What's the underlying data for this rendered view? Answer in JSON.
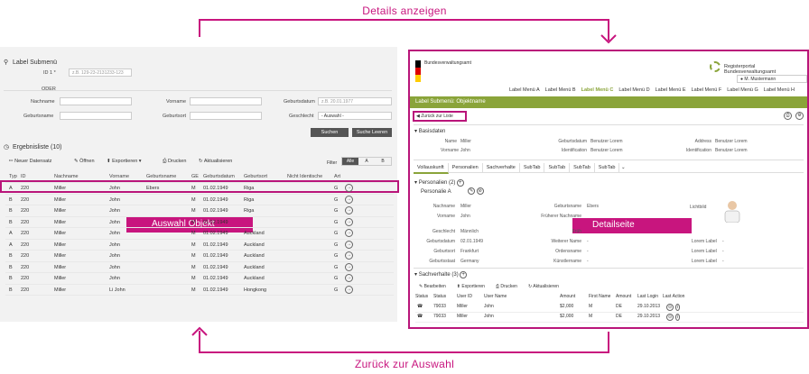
{
  "annotations": {
    "top": "Details anzeigen",
    "bottom": "Zurück zur Auswahl",
    "left_overlay": "Auswahl Objekt",
    "right_overlay": "Detailseite"
  },
  "left": {
    "title": "Label Submenü",
    "id_label": "ID 1 *",
    "id_placeholder": "z.B. 129-23-2131233-123",
    "oder": "ODER",
    "fields": {
      "nachname": "Nachname",
      "vorname": "Vorname",
      "geburtsdatum": "Geburtsdatum",
      "geburtsdatum_placeholder": "z.B. 20.01.1977",
      "geburtsname": "Geburtsname",
      "geburtsort": "Geburtsort",
      "geschlecht": "Geschlecht",
      "geschlecht_value": "- Auswahl -"
    },
    "search_btn": "Suchen",
    "reset_btn": "Suche Leeren",
    "results_title": "Ergebnisliste (10)",
    "toolbar": {
      "new": "Neuer Datensatz",
      "open": "Öffnen",
      "export": "Exportieren",
      "print": "Drucken",
      "refresh": "Aktualisieren"
    },
    "filter": {
      "label": "Filter",
      "options": [
        "Alle",
        "A",
        "B"
      ]
    },
    "columns": [
      "Typ",
      "ID",
      "Nachname",
      "Vorname",
      "Geburtsname",
      "GE",
      "Geburtsdatum",
      "Geburtsort",
      "Nicht Identische",
      "Art"
    ],
    "rows": [
      [
        "A",
        "220",
        "Miller",
        "John",
        "Ebers",
        "M",
        "01.02.1949",
        "Riga",
        "G"
      ],
      [
        "B",
        "220",
        "Miller",
        "John",
        "",
        "M",
        "01.02.1949",
        "Riga",
        "G"
      ],
      [
        "B",
        "220",
        "Miller",
        "John",
        "",
        "M",
        "01.02.1949",
        "Riga",
        "G"
      ],
      [
        "B",
        "220",
        "Miller",
        "John",
        "",
        "M",
        "01.02.1949",
        "",
        "G"
      ],
      [
        "A",
        "220",
        "Miller",
        "John",
        "",
        "M",
        "01.02.1949",
        "Auckland",
        "G"
      ],
      [
        "A",
        "220",
        "Miller",
        "John",
        "",
        "M",
        "01.02.1949",
        "Auckland",
        "G"
      ],
      [
        "B",
        "220",
        "Miller",
        "John",
        "",
        "M",
        "01.02.1949",
        "Auckland",
        "G"
      ],
      [
        "B",
        "220",
        "Miller",
        "John",
        "",
        "M",
        "01.02.1949",
        "Auckland",
        "G"
      ],
      [
        "B",
        "220",
        "Miller",
        "John",
        "",
        "M",
        "01.02.1949",
        "Auckland",
        "G"
      ],
      [
        "B",
        "220",
        "Miller",
        "Li John",
        "",
        "M",
        "01.02.1949",
        "Hongkong",
        "G"
      ]
    ]
  },
  "right": {
    "agency": "Bundesverwaltungsamt",
    "portal": "Registerportal Bundesverwaltungsamt",
    "user": "M. Mustermann",
    "menu": [
      "Label Menü A",
      "Label Menü B",
      "Label Menü C",
      "Label Menü D",
      "Label Menü E",
      "Label Menü F",
      "Label Menü G",
      "Label Menü H"
    ],
    "breadcrumb": "Label Submenü: Objektname",
    "back_btn": "Zurück zur Liste",
    "basisdaten": "Basisdaten",
    "basis_rows": [
      [
        "Name",
        "Miller",
        "Geburtsdatum",
        "Benutzer Lorem",
        "Address",
        "Benutzer Lorem"
      ],
      [
        "Vorname",
        "John",
        "Identification",
        "Benutzer Lorem",
        "Identification",
        "Benutzer Lorem"
      ]
    ],
    "tabs": [
      "Vollauskunft",
      "Personalien",
      "Sachverhalte",
      "SubTab",
      "SubTab",
      "SubTab",
      "SubTab"
    ],
    "personalien_title": "Personalien (2)",
    "personalie_a": "Personalie A",
    "pers_rows": [
      [
        "Nachname",
        "Miller",
        "Geburtsname",
        "Ebers"
      ],
      [
        "Vorname",
        "John",
        "Früherer Nachname",
        ""
      ],
      [
        "Geschlecht",
        "Männlich",
        "Früh",
        ""
      ],
      [
        "Geburtsdatum",
        "02.01.1949",
        "Weiterer Name",
        "-"
      ],
      [
        "Geburtsort",
        "Frankfurt",
        "Ordensname",
        "-"
      ],
      [
        "Geburtsstaat",
        "Germany",
        "Künstlername",
        "-"
      ]
    ],
    "lichtbild": "Lichtbild",
    "lorem_rows": [
      "Lorem Label",
      "Lorem Label",
      "Lorem Label"
    ],
    "sach_title": "Sachverhalte (3)",
    "sach_toolbar": [
      "Bearbeiten",
      "Exportieren",
      "Drucken",
      "Aktualisieren"
    ],
    "sach_cols": [
      "Status",
      "Status",
      "User ID",
      "User Name",
      "Amount",
      "First Name",
      "Amount",
      "Last Login",
      "Last Action"
    ],
    "sach_rows": [
      [
        "79033",
        "Miller",
        "John",
        "$2,000",
        "M",
        "DE",
        "29.10.2013"
      ],
      [
        "79033",
        "Miller",
        "John",
        "$2,000",
        "M",
        "DE",
        "29.10.2013"
      ]
    ]
  }
}
